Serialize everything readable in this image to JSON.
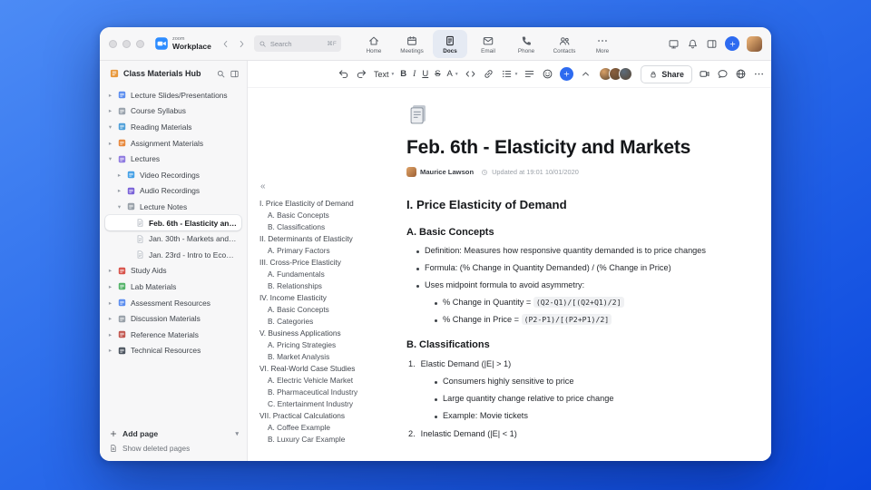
{
  "topbar": {
    "brand_small": "zoom",
    "brand": "Workplace",
    "search_placeholder": "Search",
    "search_shortcut": "⌘F",
    "tabs": [
      {
        "label": "Home",
        "icon": "home",
        "active": false
      },
      {
        "label": "Meetings",
        "icon": "meetings",
        "active": false
      },
      {
        "label": "Docs",
        "icon": "docs",
        "active": true
      },
      {
        "label": "Email",
        "icon": "email",
        "active": false
      },
      {
        "label": "Phone",
        "icon": "phone",
        "active": false
      },
      {
        "label": "Contacts",
        "icon": "contacts",
        "active": false
      },
      {
        "label": "More",
        "icon": "dots",
        "active": false
      }
    ]
  },
  "sidebar": {
    "title": "Class Materials Hub",
    "items": [
      {
        "label": "Lecture Slides/Presentations",
        "depth": 0,
        "expanded": false,
        "icon_color": "#5b8def"
      },
      {
        "label": "Course Syllabus",
        "depth": 0,
        "expanded": false,
        "icon_color": "#9aa3ad"
      },
      {
        "label": "Reading Materials",
        "depth": 0,
        "expanded": true,
        "icon_color": "#4f9fd8"
      },
      {
        "label": "Assignment Materials",
        "depth": 0,
        "expanded": false,
        "icon_color": "#e8883c"
      },
      {
        "label": "Lectures",
        "depth": 0,
        "expanded": true,
        "icon_color": "#8f7ae0"
      },
      {
        "label": "Video Recordings",
        "depth": 1,
        "expanded": false,
        "icon_color": "#45a0e6"
      },
      {
        "label": "Audio Recordings",
        "depth": 1,
        "expanded": false,
        "icon_color": "#7a62d8"
      },
      {
        "label": "Lecture Notes",
        "depth": 1,
        "expanded": true,
        "icon_color": "#98a0a8"
      },
      {
        "label": "Feb. 6th - Elasticity and M...",
        "depth": 2,
        "page": true,
        "selected": true
      },
      {
        "label": "Jan. 30th - Markets and P...",
        "depth": 2,
        "page": true,
        "selected": false
      },
      {
        "label": "Jan. 23rd - Intro to Econo...",
        "depth": 2,
        "page": true,
        "selected": false
      },
      {
        "label": "Study Aids",
        "depth": 0,
        "expanded": false,
        "icon_color": "#d8524a"
      },
      {
        "label": "Lab Materials",
        "depth": 0,
        "expanded": false,
        "icon_color": "#53b368"
      },
      {
        "label": "Assessment Resources",
        "depth": 0,
        "expanded": false,
        "icon_color": "#5b8def"
      },
      {
        "label": "Discussion Materials",
        "depth": 0,
        "expanded": false,
        "icon_color": "#98a0a8"
      },
      {
        "label": "Reference Materials",
        "depth": 0,
        "expanded": false,
        "icon_color": "#c2574f"
      },
      {
        "label": "Technical Resources",
        "depth": 0,
        "expanded": false,
        "icon_color": "#4d5560"
      }
    ],
    "add_page_label": "Add page",
    "show_deleted_label": "Show deleted pages"
  },
  "toolbar": {
    "buttons": [
      {
        "name": "undo",
        "icon": "undo"
      },
      {
        "name": "redo",
        "icon": "redo"
      },
      {
        "name": "text-style",
        "label": "Text",
        "caret": true
      },
      {
        "name": "bold",
        "glyph": "B"
      },
      {
        "name": "italic",
        "glyph": "I"
      },
      {
        "name": "underline",
        "glyph": "U"
      },
      {
        "name": "strikethrough",
        "glyph": "S"
      },
      {
        "name": "text-color",
        "glyph": "A",
        "caret": true
      },
      {
        "name": "code",
        "icon": "code"
      },
      {
        "name": "link",
        "icon": "link"
      },
      {
        "name": "bullet-list",
        "icon": "list",
        "caret": true
      },
      {
        "name": "align",
        "icon": "align"
      },
      {
        "name": "emoji",
        "icon": "emoji"
      },
      {
        "name": "insert",
        "icon": "plus",
        "accent": true
      },
      {
        "name": "collapse-toolbar",
        "icon": "chevron-up"
      }
    ],
    "collaborator_colors": [
      "#d9a066",
      "#8a5f3d",
      "#5b6b7a"
    ],
    "share_label": "Share",
    "right_buttons": [
      {
        "name": "video",
        "icon": "camera"
      },
      {
        "name": "comments",
        "icon": "comment"
      },
      {
        "name": "translate",
        "icon": "globe"
      },
      {
        "name": "more-options",
        "icon": "dots"
      }
    ],
    "accent_color": "#2e6bf0"
  },
  "document": {
    "title": "Feb. 6th - Elasticity and Markets",
    "author": "Maurice Lawson",
    "updated": "Updated at 19:01 10/01/2020",
    "outline": [
      {
        "text": "I. Price Elasticity of Demand",
        "level": 1
      },
      {
        "text": "A. Basic Concepts",
        "level": 2
      },
      {
        "text": "B. Classifications",
        "level": 2
      },
      {
        "text": "II. Determinants of Elasticity",
        "level": 1
      },
      {
        "text": "A. Primary Factors",
        "level": 2
      },
      {
        "text": "III. Cross-Price Elasticity",
        "level": 1
      },
      {
        "text": "A. Fundamentals",
        "level": 2
      },
      {
        "text": "B. Relationships",
        "level": 2
      },
      {
        "text": "IV. Income Elasticity",
        "level": 1
      },
      {
        "text": "A. Basic Concepts",
        "level": 2
      },
      {
        "text": "B. Categories",
        "level": 2
      },
      {
        "text": "V. Business Applications",
        "level": 1
      },
      {
        "text": "A. Pricing Strategies",
        "level": 2
      },
      {
        "text": "B. Market Analysis",
        "level": 2
      },
      {
        "text": "VI. Real-World Case Studies",
        "level": 1
      },
      {
        "text": "A. Electric Vehicle Market",
        "level": 2
      },
      {
        "text": "B. Pharmaceutical Industry",
        "level": 2
      },
      {
        "text": "C. Entertainment Industry",
        "level": 2
      },
      {
        "text": "VII. Practical Calculations",
        "level": 1
      },
      {
        "text": "A. Coffee Example",
        "level": 2
      },
      {
        "text": "B. Luxury Car Example",
        "level": 2
      }
    ],
    "blocks": [
      {
        "type": "h2",
        "text": "I. Price Elasticity of Demand"
      },
      {
        "type": "h3",
        "text": "A. Basic Concepts"
      },
      {
        "type": "li",
        "level": 0,
        "segments": [
          {
            "t": "Definition: Measures how responsive quantity demanded is to price changes"
          }
        ]
      },
      {
        "type": "li",
        "level": 0,
        "segments": [
          {
            "t": "Formula: (% Change in Quantity Demanded) / (% Change in Price)"
          }
        ]
      },
      {
        "type": "li",
        "level": 0,
        "segments": [
          {
            "t": "Uses midpoint formula to avoid asymmetry:"
          }
        ]
      },
      {
        "type": "li",
        "level": 1,
        "segments": [
          {
            "t": "% Change in Quantity = "
          },
          {
            "t": "(Q2-Q1)/[(Q2+Q1)/2]",
            "code": true
          }
        ]
      },
      {
        "type": "li",
        "level": 1,
        "segments": [
          {
            "t": "% Change in Price = "
          },
          {
            "t": "(P2-P1)/[(P2+P1)/2]",
            "code": true
          }
        ]
      },
      {
        "type": "h3",
        "text": "B. Classifications"
      },
      {
        "type": "oli",
        "num": "1.",
        "segments": [
          {
            "t": "Elastic Demand (|E| > 1)"
          }
        ]
      },
      {
        "type": "li",
        "level": 1,
        "segments": [
          {
            "t": "Consumers highly sensitive to price"
          }
        ]
      },
      {
        "type": "li",
        "level": 1,
        "segments": [
          {
            "t": "Large quantity change relative to price change"
          }
        ]
      },
      {
        "type": "li",
        "level": 1,
        "segments": [
          {
            "t": "Example: Movie tickets"
          }
        ]
      },
      {
        "type": "oli",
        "num": "2.",
        "segments": [
          {
            "t": "Inelastic Demand (|E| < 1)"
          }
        ]
      }
    ]
  }
}
